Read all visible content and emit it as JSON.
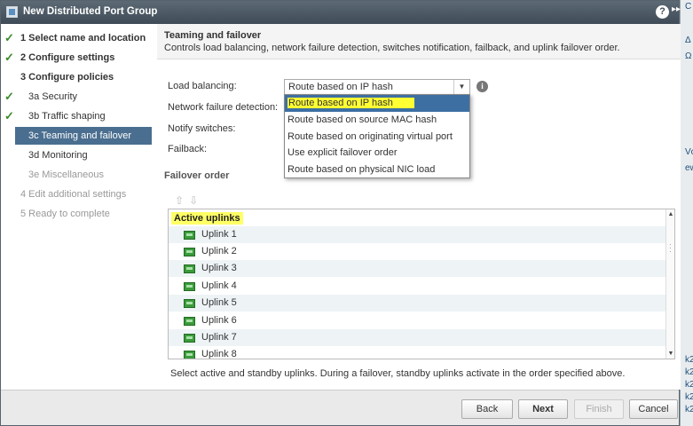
{
  "window": {
    "title": "New Distributed Port Group",
    "help": "?",
    "more": "▸▸"
  },
  "background": {
    "labels": [
      "C",
      "Δ",
      "Ω",
      "Vc",
      "ew",
      "k2",
      "k2",
      "k2",
      "k2",
      "k2"
    ]
  },
  "steps": [
    {
      "num": "1",
      "label": "Select name and location",
      "status": "done",
      "bold": true
    },
    {
      "num": "2",
      "label": "Configure settings",
      "status": "done",
      "bold": true
    },
    {
      "num": "3",
      "label": "Configure policies",
      "status": "",
      "bold": true
    },
    {
      "num": "3a",
      "label": "Security",
      "status": "done",
      "sub": true
    },
    {
      "num": "3b",
      "label": "Traffic shaping",
      "status": "done",
      "sub": true
    },
    {
      "num": "3c",
      "label": "Teaming and failover",
      "status": "active",
      "sub": true
    },
    {
      "num": "3d",
      "label": "Monitoring",
      "status": "",
      "sub": true
    },
    {
      "num": "3e",
      "label": "Miscellaneous",
      "status": "disabled",
      "sub": true
    },
    {
      "num": "4",
      "label": "Edit additional settings",
      "status": "pending"
    },
    {
      "num": "5",
      "label": "Ready to complete",
      "status": "pending"
    }
  ],
  "steps_text": [
    "1  Select name and location",
    "2  Configure settings",
    "3  Configure policies",
    "3a  Security",
    "3b  Traffic shaping",
    "3c  Teaming and failover",
    "3d  Monitoring",
    "3e  Miscellaneous",
    "4  Edit additional settings",
    "5  Ready to complete"
  ],
  "section": {
    "title": "Teaming and failover",
    "description": "Controls load balancing, network failure detection, switches notification, failback, and uplink failover order."
  },
  "form": {
    "load_balancing_label": "Load balancing:",
    "load_balancing_value": "Route based on IP hash",
    "network_failure_label": "Network failure detection:",
    "notify_switches_label": "Notify switches:",
    "failback_label": "Failback:"
  },
  "dropdown_options": [
    "Route based on IP hash",
    "Route based on source MAC hash",
    "Route based on originating virtual port",
    "Use explicit failover order",
    "Route based on physical NIC load"
  ],
  "failover": {
    "title": "Failover order",
    "active_header": "Active uplinks",
    "uplinks": [
      "Uplink 1",
      "Uplink 2",
      "Uplink 3",
      "Uplink 4",
      "Uplink 5",
      "Uplink 6",
      "Uplink 7",
      "Uplink 8"
    ],
    "hint": "Select active and standby uplinks. During a failover, standby uplinks activate in the order specified above."
  },
  "buttons": {
    "back": "Back",
    "next": "Next",
    "finish": "Finish",
    "cancel": "Cancel"
  },
  "colors": {
    "titlebar": "#4a5763",
    "active_step": "#4a6e8f",
    "highlight": "#ffff33",
    "check": "#3b8a29"
  }
}
